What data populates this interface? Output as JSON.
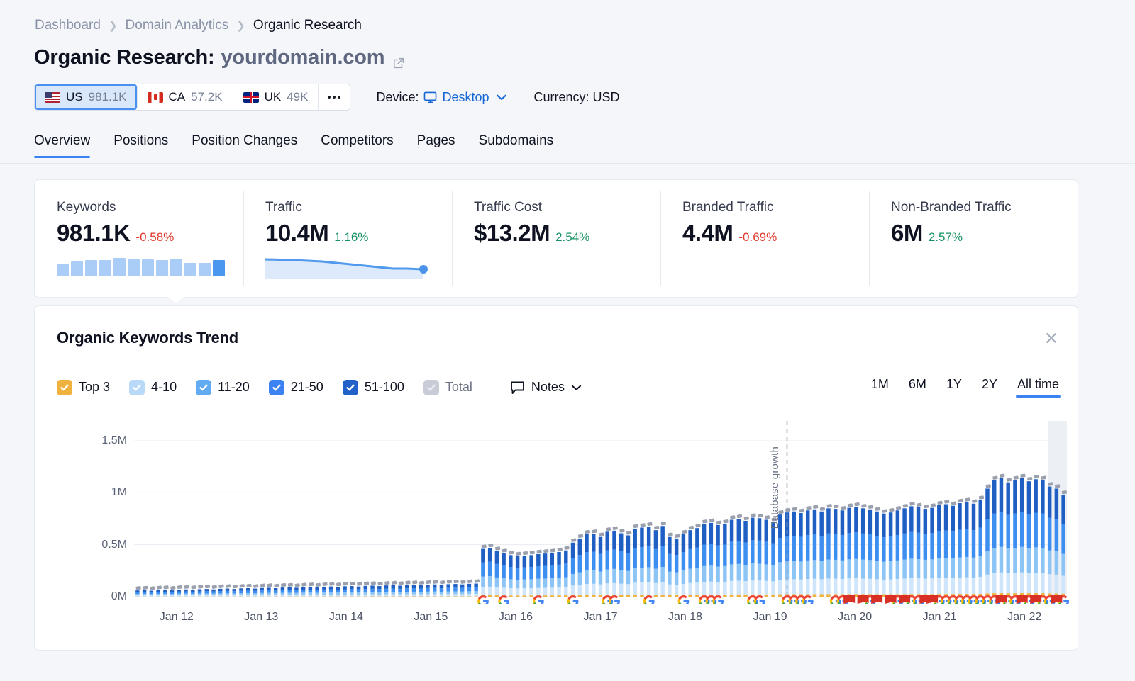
{
  "breadcrumb": [
    {
      "label": "Dashboard",
      "current": false
    },
    {
      "label": "Domain Analytics",
      "current": false
    },
    {
      "label": "Organic Research",
      "current": true
    }
  ],
  "header": {
    "title_prefix": "Organic Research:",
    "domain": "yourdomain.com",
    "external_link_icon": "external-link-icon"
  },
  "filters": {
    "countries": [
      {
        "code": "US",
        "value": "981.1K",
        "flag": "us-flag-icon",
        "active": true
      },
      {
        "code": "CA",
        "value": "57.2K",
        "flag": "ca-flag-icon",
        "active": false
      },
      {
        "code": "UK",
        "value": "49K",
        "flag": "uk-flag-icon",
        "active": false
      }
    ],
    "more_label": "•••",
    "device_label": "Device:",
    "device_value": "Desktop",
    "device_icon": "monitor-icon",
    "currency_label": "Currency: USD"
  },
  "tabs": [
    {
      "label": "Overview",
      "active": true
    },
    {
      "label": "Positions",
      "active": false
    },
    {
      "label": "Position Changes",
      "active": false
    },
    {
      "label": "Competitors",
      "active": false
    },
    {
      "label": "Pages",
      "active": false
    },
    {
      "label": "Subdomains",
      "active": false
    }
  ],
  "metrics": [
    {
      "label": "Keywords",
      "value": "981.1K",
      "delta": "-0.58%",
      "direction": "down",
      "spark": "bars"
    },
    {
      "label": "Traffic",
      "value": "10.4M",
      "delta": "1.16%",
      "direction": "up",
      "spark": "area"
    },
    {
      "label": "Traffic Cost",
      "value": "$13.2M",
      "delta": "2.54%",
      "direction": "up",
      "spark": "none"
    },
    {
      "label": "Branded Traffic",
      "value": "4.4M",
      "delta": "-0.69%",
      "direction": "down",
      "spark": "none"
    },
    {
      "label": "Non-Branded Traffic",
      "value": "6M",
      "delta": "2.57%",
      "direction": "up",
      "spark": "none"
    }
  ],
  "panel": {
    "title": "Organic Keywords Trend",
    "close_icon": "close-icon",
    "notes_label": "Notes",
    "notes_icon": "note-icon",
    "legend": [
      {
        "label": "Top 3",
        "color": "#f0b23f",
        "checked": true,
        "disabled": false
      },
      {
        "label": "4-10",
        "color": "#b8d9f8",
        "checked": true,
        "disabled": false
      },
      {
        "label": "11-20",
        "color": "#62abf2",
        "checked": true,
        "disabled": false
      },
      {
        "label": "21-50",
        "color": "#3c82f3",
        "checked": true,
        "disabled": false
      },
      {
        "label": "51-100",
        "color": "#2062c9",
        "checked": true,
        "disabled": false
      },
      {
        "label": "Total",
        "color": "#c7ccd7",
        "checked": true,
        "disabled": true
      }
    ],
    "ranges": [
      {
        "label": "1M",
        "active": false
      },
      {
        "label": "6M",
        "active": false
      },
      {
        "label": "1Y",
        "active": false
      },
      {
        "label": "2Y",
        "active": false
      },
      {
        "label": "All time",
        "active": true
      }
    ],
    "annotation": "Database growth"
  },
  "chart_data": {
    "type": "bar",
    "stacked": true,
    "title": "Organic Keywords Trend",
    "xlabel": "",
    "ylabel": "",
    "grid": true,
    "legend_position": "top-left",
    "ylim": [
      0,
      1650000
    ],
    "yticks": [
      0,
      500000,
      1000000,
      1500000
    ],
    "ytick_labels": [
      "0M",
      "0.5M",
      "1M",
      "1.5M"
    ],
    "xtick_labels": [
      "Jan 12",
      "Jan 13",
      "Jan 14",
      "Jan 15",
      "Jan 16",
      "Jan 17",
      "Jan 18",
      "Jan 19",
      "Jan 20",
      "Jan 21",
      "Jan 22"
    ],
    "series": [
      {
        "name": "Top 3",
        "color": "#f0b23f"
      },
      {
        "name": "4-10",
        "color": "#cfe5fb"
      },
      {
        "name": "11-20",
        "color": "#8cc4f6"
      },
      {
        "name": "21-50",
        "color": "#3c8ef0"
      },
      {
        "name": "51-100",
        "color": "#1f5fc4"
      },
      {
        "name": "Total",
        "color": "#9aa0ad"
      }
    ],
    "totals": [
      60000,
      62000,
      58000,
      64000,
      66000,
      61000,
      68000,
      70000,
      66000,
      72000,
      74000,
      70000,
      76000,
      78000,
      74000,
      80000,
      82000,
      78000,
      84000,
      86000,
      82000,
      88000,
      90000,
      86000,
      92000,
      94000,
      90000,
      96000,
      98000,
      94000,
      100000,
      102000,
      98000,
      104000,
      106000,
      102000,
      108000,
      110000,
      106000,
      112000,
      114000,
      110000,
      116000,
      118000,
      114000,
      120000,
      122000,
      118000,
      124000,
      126000,
      460000,
      470000,
      440000,
      420000,
      400000,
      390000,
      395000,
      400000,
      410000,
      415000,
      420000,
      430000,
      445000,
      520000,
      560000,
      600000,
      605000,
      575000,
      625000,
      635000,
      610000,
      590000,
      655000,
      665000,
      675000,
      640000,
      680000,
      575000,
      560000,
      600000,
      640000,
      660000,
      700000,
      710000,
      690000,
      700000,
      740000,
      750000,
      730000,
      760000,
      755000,
      740000,
      720000,
      790000,
      810000,
      820000,
      805000,
      830000,
      840000,
      820000,
      850000,
      845000,
      830000,
      855000,
      865000,
      850000,
      840000,
      820000,
      800000,
      810000,
      830000,
      850000,
      870000,
      860000,
      845000,
      855000,
      880000,
      890000,
      875000,
      900000,
      910000,
      895000,
      930000,
      1040000,
      1120000,
      1140000,
      1100000,
      1120000,
      1140000,
      1110000,
      1130000,
      1120000,
      1060000,
      1040000,
      980000
    ],
    "annotations": [
      {
        "label": "Database growth",
        "type": "vline",
        "x_position": 0.7,
        "style": "dashed"
      }
    ],
    "event_markers": {
      "google_update_icon": "google-g-icon",
      "semrush_sensor_icon": "red-flag-icon",
      "description": "Google algorithm update markers (G) and red flag markers along the x-axis baseline"
    },
    "highlight_band": {
      "position": "right-edge",
      "color": "#eceff4"
    }
  }
}
